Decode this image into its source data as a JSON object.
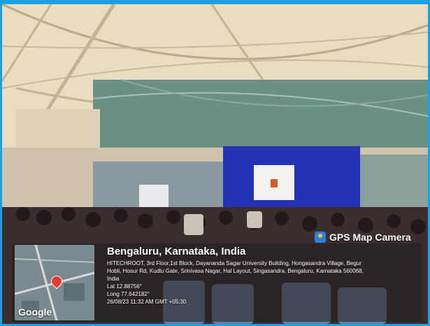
{
  "camera_badge": {
    "label": "GPS Map Camera",
    "icon": "gps-camera-icon"
  },
  "location": {
    "title": "Bengaluru, Karnataka, India",
    "address_lines": [
      "HITECHROOT, 3rd Floor,1st Block, Dayananda Sagar University Building, Hongasandra Village, Begur",
      "Hobli, Hosur Rd, Kudlu Gate, Srinivasa Nagar, Hal Layout, Singasandra, Bengaluru, Karnataka 560068,",
      "India"
    ],
    "lat": "Lat 12.88756°",
    "long": "Long 77.642182°",
    "datetime": "26/08/23 11:32 AM GMT +05:30"
  },
  "map_thumb": {
    "logo": "Google"
  },
  "colors": {
    "frame": "#1aa0e6",
    "stage_backdrop": "#2233b5",
    "canopy": "#e8d8b8"
  }
}
